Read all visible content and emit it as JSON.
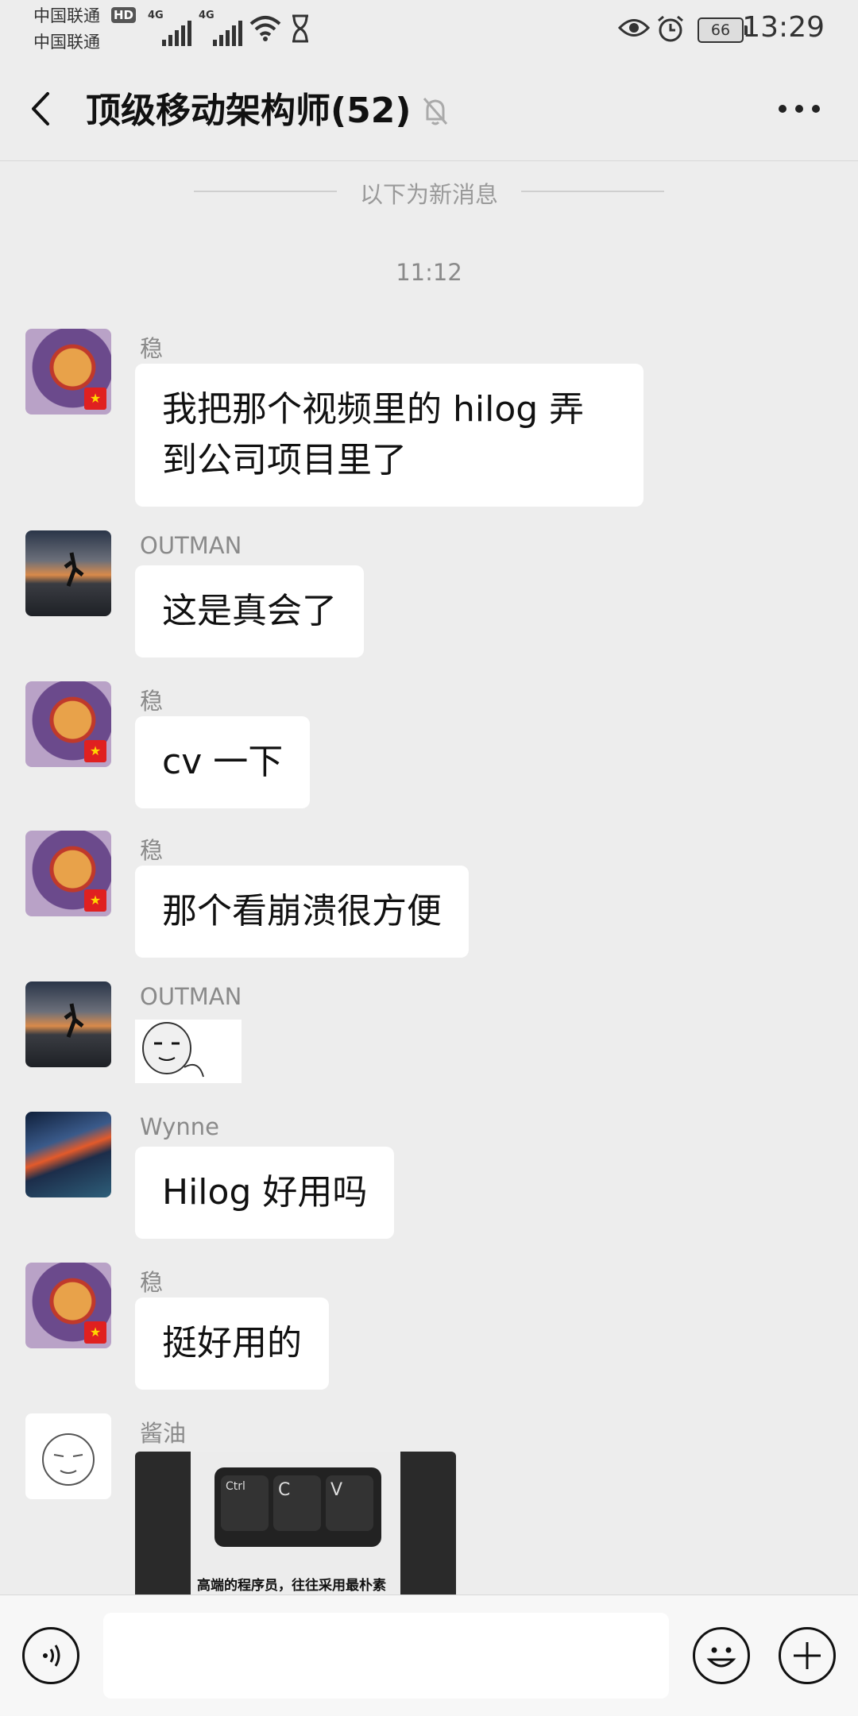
{
  "status": {
    "carrier1": "中国联通",
    "carrier2": "中国联通",
    "hd": "HD",
    "net1": "4G",
    "net2": "4G",
    "battery": "66",
    "time": "13:29"
  },
  "header": {
    "title": "顶级移动架构师(52)"
  },
  "chat": {
    "new_messages_divider": "以下为新消息",
    "timestamp": "11:12",
    "messages": [
      {
        "sender": "稳",
        "text": "我把那个视频里的 hilog 弄到公司项目里了",
        "avatar": "monkey-king-avatar"
      },
      {
        "sender": "OUTMAN",
        "text": "这是真会了",
        "avatar": "sunset-avatar"
      },
      {
        "sender": "稳",
        "text": "cv 一下",
        "avatar": "monkey-king-avatar"
      },
      {
        "sender": "稳",
        "text": "那个看崩溃很方便",
        "avatar": "monkey-king-avatar"
      },
      {
        "sender": "OUTMAN",
        "text": "",
        "avatar": "sunset-avatar",
        "sticker": "meme-face-sticker"
      },
      {
        "sender": "Wynne",
        "text": "Hilog 好用吗",
        "avatar": "storm-avatar"
      },
      {
        "sender": "稳",
        "text": "挺好用的",
        "avatar": "monkey-king-avatar"
      },
      {
        "sender": "酱油",
        "text": "",
        "avatar": "sketch-avatar",
        "image_caption": "高端的程序员，往往采用最朴素",
        "image_keys": [
          "Ctrl",
          "C",
          "V"
        ]
      }
    ]
  },
  "colors": {
    "background": "#ededed",
    "bubble": "#ffffff",
    "flag": "#e02020"
  }
}
